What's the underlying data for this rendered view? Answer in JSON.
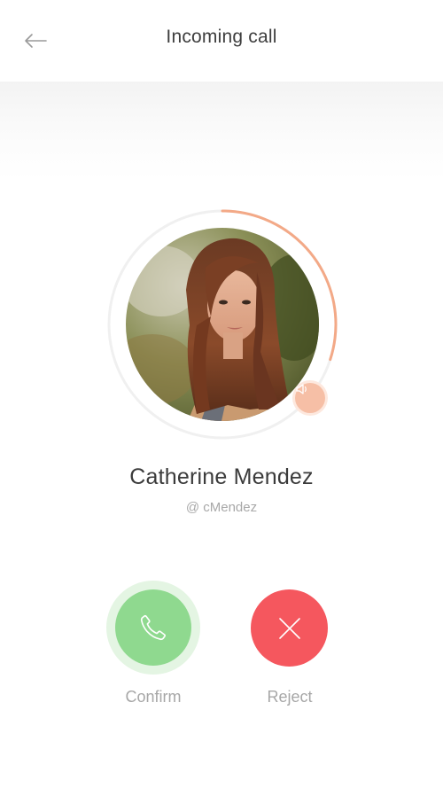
{
  "header": {
    "title": "Incoming call"
  },
  "caller": {
    "name": "Catherine Mendez",
    "handle": "@ cMendez",
    "ring_progress": 0.3
  },
  "actions": {
    "confirm_label": "Confirm",
    "reject_label": "Reject"
  },
  "colors": {
    "accent_orange": "#f3a987",
    "confirm_green": "#8fd98f",
    "reject_red": "#f5575e"
  },
  "icons": {
    "back": "back-arrow-icon",
    "speaker": "speaker-icon",
    "phone": "phone-icon",
    "close": "close-icon"
  }
}
